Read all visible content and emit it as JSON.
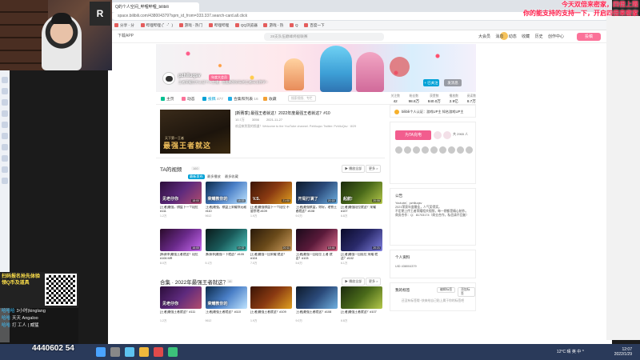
{
  "overlay": {
    "top_line1": "今天双倍来密家，四倍上限",
    "top_line2": "你的能支持的支持一下，开启四倍来密家",
    "qr_title": "扫码报名抢先体验领Q币及道具",
    "viewers": [
      {
        "name": "哈哈哈",
        "text": "3小时(kinglang"
      },
      {
        "name": "哈哈",
        "text": "天天 Angaloo"
      },
      {
        "name": "哈哈",
        "text": "打 工人 | 威猛"
      }
    ],
    "phone": "4440602 54",
    "number": "315151 4 7"
  },
  "browser": {
    "tab_title": "Q的个人空间_哔哩哔哩_bilibili",
    "url": "space.bilibili.com/438004379?spm_id_from=333.337.search-card.all.click",
    "bookmarks": [
      "分享 - 分",
      "哔哩哔哩 (゜-゜)",
      "游戏 - 热门",
      "哔哩哔哩",
      "QQ浏览器",
      "游戏 - 热",
      "Q",
      "百度一下"
    ]
  },
  "header": {
    "download": "下载APP",
    "search_placeholder": "28支队伍巅峰终极联赛",
    "nav": [
      "大会员",
      "消息",
      "动态",
      "收藏",
      "历史",
      "创作中心"
    ],
    "upload": "投稿"
  },
  "space": {
    "name": "pzhlluqsv",
    "tag": "年度大会员",
    "sign": "王者荣耀官方认证个人主播，各类新鲜好玩的王者玩法教学~",
    "follow": "+ 已关注",
    "message": "发消息",
    "nav": [
      {
        "label": "主页",
        "count": ""
      },
      {
        "label": "动态",
        "count": ""
      },
      {
        "label": "投稿",
        "count": "477"
      },
      {
        "label": "合集和列表",
        "count": "16"
      },
      {
        "label": "收藏",
        "count": ""
      }
    ],
    "search_placeholder": "搜索视频、专栏",
    "stats": [
      {
        "label": "关注数",
        "value": "42"
      },
      {
        "label": "粉丝数",
        "value": "98.8万"
      },
      {
        "label": "获赞数",
        "value": "840.0万"
      },
      {
        "label": "播放数",
        "value": "2.9亿"
      },
      {
        "label": "阅读数",
        "value": "8.7万"
      }
    ]
  },
  "feature": {
    "title": "[新赛季] 最强王者就这！2022年度最强王者就这？#10",
    "views": "10.7万",
    "comments": "3056",
    "date": "2021-11-27",
    "desc": "欢迎来到我的频道！Welcome to the YouTube channel. Pzhlluqsv Twitter: PzhlluQsv · 8/29",
    "thumb_small": "天下第一王者",
    "thumb_big": "最强王者就这"
  },
  "videos_section": {
    "title": "TA的视频",
    "count": "160",
    "sort": [
      "最新发布",
      "最多播放",
      "最多收藏"
    ],
    "play_all": "▶ 播放全部",
    "more": "更多 >"
  },
  "videos": [
    {
      "thumb": "见老仔你",
      "title": "[王者]最强，棋盘下一个段位 #111",
      "views": "1.2万",
      "dur": "18:00"
    },
    {
      "thumb": "荣耀教你的",
      "title": "[王者]最强，棋盘上荣耀你无敌 #110",
      "views": "9612",
      "dur": "18:33"
    },
    {
      "thumb": "V.S.",
      "title": "[王者]最强棋盘下一个段位 不留余地 #109",
      "views": "1.9万",
      "dur": "21:00"
    },
    {
      "thumb": "开局打满了",
      "title": "[王者]最强棋盘，你好，老铁王者就这？#108",
      "views": "9.0万",
      "dur": "20:18"
    },
    {
      "thumb": "起航!",
      "title": "[王者]最强段位就这？荣耀#107",
      "views": "6.8万",
      "dur": "20:06"
    },
    {
      "thumb": "",
      "title": "[新赛季]最强王者就这？段位 #106 MR",
      "views": "8.0万",
      "dur": "16:00"
    },
    {
      "thumb": "",
      "title": "[新赛季]最强一下就这？#105",
      "views": "5.1万",
      "dur": "19:32"
    },
    {
      "thumb": "",
      "title": "[王者]最强一回荣耀 就这？#104",
      "views": "7.0万",
      "dur": "20:11"
    },
    {
      "thumb": "",
      "title": "[王者]最强一回段位 王者 就这？#103",
      "views": "5.6万",
      "dur": "18:44"
    },
    {
      "thumb": "",
      "title": "[王者]最强一回段位 荣耀 就这？#102",
      "views": "6.1万",
      "dur": "20:21"
    }
  ],
  "collection_section": {
    "title": "合集 · 2022年最强王者就这？",
    "count": "16",
    "play_all": "▶ 播放全部",
    "more": "更多 >"
  },
  "collection": [
    {
      "thumb": "见老仔你",
      "title": "[王者]最强王者就这？#111",
      "views": "1.2万"
    },
    {
      "thumb": "荣耀教你的",
      "title": "[王者]最强王者就这？#110",
      "views": "9612"
    },
    {
      "thumb": "",
      "title": "[王者]最强王者就这？#109",
      "views": "1.9万"
    },
    {
      "thumb": "",
      "title": "[王者]最强王者就这？#108",
      "views": "9.0万"
    },
    {
      "thumb": "",
      "title": "[王者]最强王者就这？#107",
      "views": "6.8万"
    }
  ],
  "sidebar": {
    "verify": "bilibili个人认证：游戏UP主 知名游戏UP主",
    "charge_btn": "为TA充电",
    "charge_count": "共 2965 人",
    "announce_title": "公告",
    "announce_body": "Youtube：pzhlluqsv\n2021荣获年度最佳，人气奖得奖。\n不定期上传王者荣耀相关视频，每一期都是精心制作。\n商务合作：Q：81703174（商业合作，私信请不回复）",
    "info_title": "个人资料",
    "info_uid": "UID    438004379",
    "tags_title": "我的标签",
    "tags_edit": "编辑标签",
    "tags_add": "添加标签",
    "tags_empty": "还没有标签哦~快来给自己贴上属于你的标签吧"
  },
  "taskbar": {
    "tray": "12°C 晴 英 中 ^",
    "time": "12:07",
    "date": "2022/1/29"
  }
}
